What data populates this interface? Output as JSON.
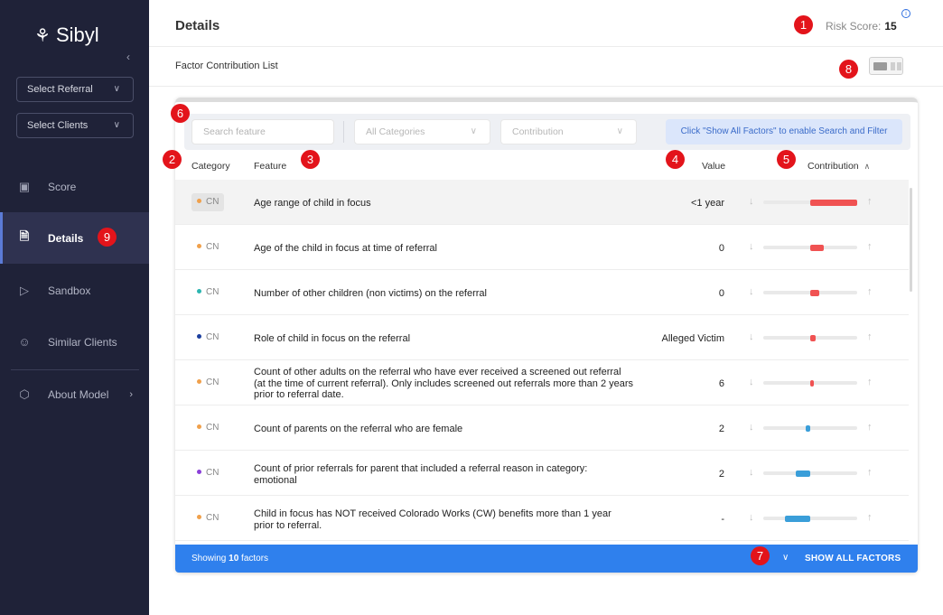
{
  "sidebar": {
    "logo": "Sibyl",
    "collapse_icon": "chevron-left-icon",
    "select_referral": "Select Referral",
    "select_clients": "Select Clients",
    "nav": [
      {
        "label": "Score",
        "icon": "chart-icon"
      },
      {
        "label": "Details",
        "icon": "document-icon"
      },
      {
        "label": "Sandbox",
        "icon": "sandbox-icon"
      },
      {
        "label": "Similar Clients",
        "icon": "users-icon"
      },
      {
        "label": "About Model",
        "icon": "cube-icon"
      }
    ]
  },
  "header": {
    "title": "Details",
    "risk_label": "Risk Score:",
    "risk_value": "15",
    "info": "i"
  },
  "subheader": {
    "title": "Factor Contribution List"
  },
  "filters": {
    "search_placeholder": "Search feature",
    "categories": "All Categories",
    "contribution": "Contribution",
    "show_all_hint": "Click \"Show All Factors\" to enable Search and Filter"
  },
  "table": {
    "headers": {
      "category": "Category",
      "feature": "Feature",
      "value": "Value",
      "contribution": "Contribution"
    },
    "rows": [
      {
        "category": "CN",
        "dot": "#f0a04b",
        "feature": "Age range of child in focus",
        "value": "<1 year",
        "bar_color": "#f05252",
        "contribution": 0.51
      },
      {
        "category": "CN",
        "dot": "#f0a04b",
        "feature": "Age of the child in focus at time of referral",
        "value": "0",
        "bar_color": "#f05252",
        "contribution": 0.14
      },
      {
        "category": "CN",
        "dot": "#2cb5b0",
        "feature": "Number of other children (non victims) on the referral",
        "value": "0",
        "bar_color": "#f05252",
        "contribution": 0.1
      },
      {
        "category": "CN",
        "dot": "#1c3f9e",
        "feature": "Role of child in focus on the referral",
        "value": "Alleged Victim",
        "bar_color": "#f05252",
        "contribution": 0.06
      },
      {
        "category": "CN",
        "dot": "#f0a04b",
        "feature": "Count of other adults on the referral who have ever received a screened out referral (at the time of current referral). Only includes screened out referrals more than 2 years prior to referral date.",
        "value": "6",
        "bar_color": "#f05252",
        "contribution": 0.03
      },
      {
        "category": "CN",
        "dot": "#f0a04b",
        "feature": "Count of parents on the referral who are female",
        "value": "2",
        "bar_color": "#3a9ed9",
        "contribution": -0.05
      },
      {
        "category": "CN",
        "dot": "#8b3fd9",
        "feature": "Count of prior referrals for parent that included a referral reason in category: emotional",
        "value": "2",
        "bar_color": "#3a9ed9",
        "contribution": -0.15
      },
      {
        "category": "CN",
        "dot": "#f0a04b",
        "feature": "Child in focus has NOT received Colorado Works (CW) benefits more than 1 year prior to referral.",
        "value": "-",
        "bar_color": "#3a9ed9",
        "contribution": -0.27
      }
    ]
  },
  "footer": {
    "showing_prefix": "Showing ",
    "showing_count": "10",
    "showing_suffix": " factors",
    "show_all": "SHOW ALL FACTORS"
  },
  "markers": [
    "1",
    "2",
    "3",
    "4",
    "5",
    "6",
    "7",
    "8",
    "9"
  ]
}
